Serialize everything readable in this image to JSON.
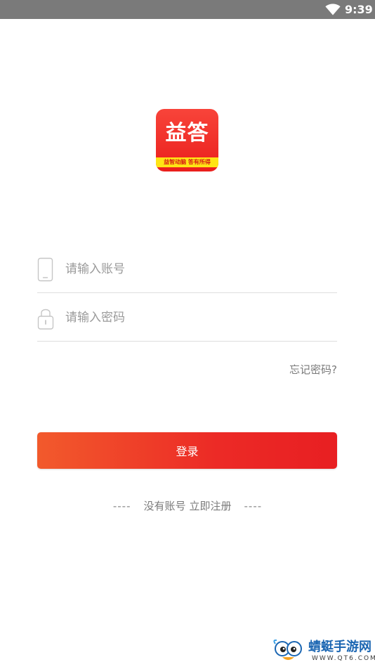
{
  "status_bar": {
    "time": "9:39",
    "wifi_icon": "wifi-icon"
  },
  "logo": {
    "main_text": "益答",
    "slogan": "益智动脑 答有所得",
    "colors": {
      "background": "#ea1f1c",
      "band": "#ffe414"
    }
  },
  "form": {
    "account": {
      "placeholder": "请输入账号",
      "value": "",
      "icon": "phone-icon"
    },
    "password": {
      "placeholder": "请输入密码",
      "value": "",
      "icon": "lock-icon"
    },
    "forgot_label": "忘记密码?"
  },
  "login": {
    "label": "登录",
    "colors": {
      "start": "#f25a2c",
      "end": "#e81f22"
    }
  },
  "register": {
    "dash_left": "----",
    "text": "没有账号",
    "link": "立即注册",
    "dash_right": "----"
  },
  "watermark": {
    "title": "蜻蜓手游网",
    "url": "WWW.QT6.COM"
  }
}
